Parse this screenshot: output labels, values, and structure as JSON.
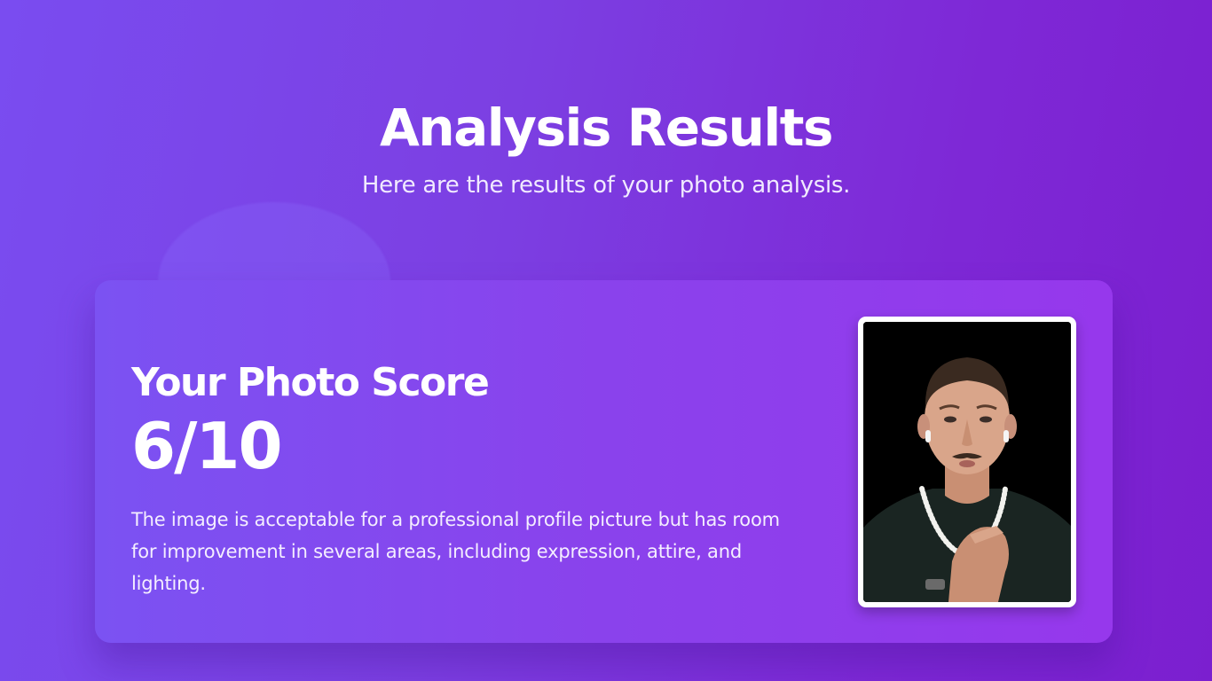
{
  "header": {
    "title": "Analysis Results",
    "subtitle": "Here are the results of your photo analysis."
  },
  "result": {
    "score_label": "Your Photo Score",
    "score_value": "6/10",
    "description": "The image is acceptable for a professional profile picture but has room for improvement in several areas, including expression, attire, and lighting."
  },
  "photo": {
    "subject": "portrait of a man with slicked-back hair and mustache, pearl necklace, dark shirt, black background"
  },
  "colors": {
    "background_start": "#7a4cf0",
    "background_end": "#7b1fcf",
    "card_start": "#7b52f2",
    "card_end": "#9638ec",
    "text": "#ffffff"
  }
}
